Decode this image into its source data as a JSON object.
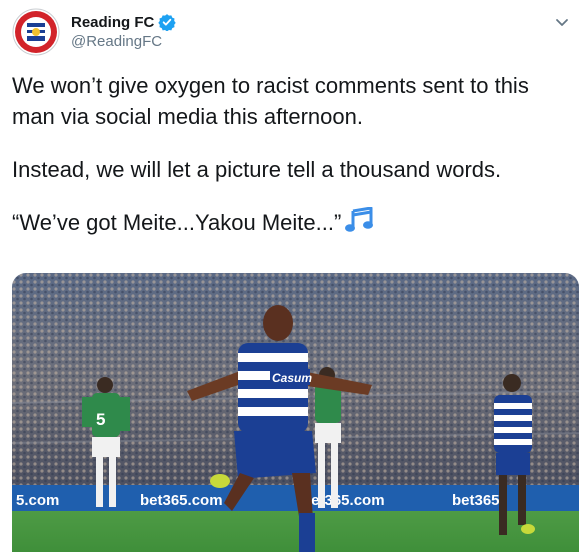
{
  "tweet": {
    "author": {
      "display_name": "Reading FC",
      "handle": "@ReadingFC",
      "verified": true,
      "avatar_icon": "reading-fc-crest"
    },
    "paragraphs": [
      "We won’t give oxygen to racist comments sent to this man via social media this afternoon.",
      "Instead, we will let a picture tell a thousand words.",
      "“We’ve got Meite...Yakou Meite...”"
    ],
    "emoji": "musical-notes-icon",
    "media": {
      "description_icon": "player-celebration-photo",
      "sponsor_text": "bet365.com"
    }
  },
  "colors": {
    "verified_blue": "#1da1f2",
    "handle_gray": "#657786",
    "pitch_green": "#3f8f3a",
    "kit_blue": "#1b3f94"
  }
}
